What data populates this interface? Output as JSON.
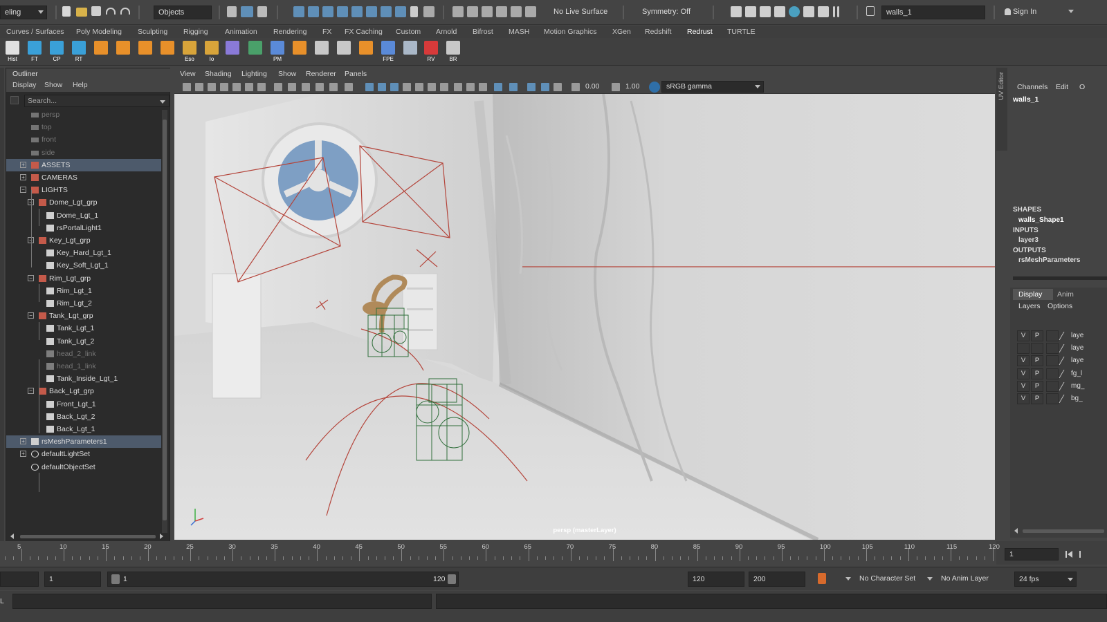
{
  "statusline": {
    "mode_menu": "eling",
    "selection_mask": "Objects",
    "live_surface": "No Live Surface",
    "symmetry": "Symmetry: Off",
    "name_field": "walls_1",
    "sign_in": "Sign In"
  },
  "shelf_tabs": [
    "Curves / Surfaces",
    "Poly Modeling",
    "Sculpting",
    "Rigging",
    "Animation",
    "Rendering",
    "FX",
    "FX Caching",
    "Custom",
    "Arnold",
    "Bifrost",
    "MASH",
    "Motion Graphics",
    "XGen",
    "Redshift",
    "Redrust",
    "TURTLE"
  ],
  "active_shelf_tab": "Redrust",
  "shelf_buttons": [
    {
      "label": "Hist",
      "icon": "history-icon"
    },
    {
      "label": "FT",
      "icon": "freeze-transform-icon"
    },
    {
      "label": "CP",
      "icon": "center-pivot-icon"
    },
    {
      "label": "RT",
      "icon": "reset-transform-icon"
    },
    {
      "label": "",
      "icon": "sphere-grid-icon"
    },
    {
      "label": "",
      "icon": "cube-grid-icon"
    },
    {
      "label": "",
      "icon": "cylinder-grid-icon"
    },
    {
      "label": "",
      "icon": "diamond-icon"
    },
    {
      "label": "Eso",
      "icon": "folder-eso-icon"
    },
    {
      "label": "Io",
      "icon": "folder-io-icon"
    },
    {
      "label": "",
      "icon": "wire-cube-icon"
    },
    {
      "label": "",
      "icon": "uv-grid-icon"
    },
    {
      "label": "PM",
      "icon": "pm-monitor-icon"
    },
    {
      "label": "",
      "icon": "hand-icon"
    },
    {
      "label": "",
      "icon": "mug-icon"
    },
    {
      "label": "",
      "icon": "grid-window-icon"
    },
    {
      "label": "",
      "icon": "align-icon"
    },
    {
      "label": "FPE",
      "icon": "fpe-monitor-icon"
    },
    {
      "label": "",
      "icon": "render-setup-icon"
    },
    {
      "label": "RV",
      "icon": "render-view-icon"
    },
    {
      "label": "BR",
      "icon": "batch-render-icon"
    }
  ],
  "outliner": {
    "title": "Outliner",
    "menus": [
      "Display",
      "Show",
      "Help"
    ],
    "search_placeholder": "Search...",
    "items": [
      {
        "label": "persp",
        "depth": 0,
        "dim": true,
        "icon": "camera-icon",
        "exp": ""
      },
      {
        "label": "top",
        "depth": 0,
        "dim": true,
        "icon": "camera-icon",
        "exp": ""
      },
      {
        "label": "front",
        "depth": 0,
        "dim": true,
        "icon": "camera-icon",
        "exp": ""
      },
      {
        "label": "side",
        "depth": 0,
        "dim": true,
        "icon": "camera-icon",
        "exp": ""
      },
      {
        "label": "ASSETS",
        "depth": 0,
        "icon": "group-icon",
        "exp": "+",
        "selected": true
      },
      {
        "label": "CAMERAS",
        "depth": 0,
        "icon": "group-icon",
        "exp": "+"
      },
      {
        "label": "LIGHTS",
        "depth": 0,
        "icon": "group-icon",
        "exp": "-"
      },
      {
        "label": "Dome_Lgt_grp",
        "depth": 1,
        "icon": "group-icon",
        "exp": "-"
      },
      {
        "label": "Dome_Lgt_1",
        "depth": 2,
        "icon": "light-icon",
        "exp": ""
      },
      {
        "label": "rsPortalLight1",
        "depth": 2,
        "icon": "light-icon",
        "exp": ""
      },
      {
        "label": "Key_Lgt_grp",
        "depth": 1,
        "icon": "group-icon",
        "exp": "-"
      },
      {
        "label": "Key_Hard_Lgt_1",
        "depth": 2,
        "icon": "light-icon",
        "exp": ""
      },
      {
        "label": "Key_Soft_Lgt_1",
        "depth": 2,
        "icon": "light-icon",
        "exp": ""
      },
      {
        "label": "Rim_Lgt_grp",
        "depth": 1,
        "icon": "group-icon",
        "exp": "-"
      },
      {
        "label": "Rim_Lgt_1",
        "depth": 2,
        "icon": "light-icon",
        "exp": ""
      },
      {
        "label": "Rim_Lgt_2",
        "depth": 2,
        "icon": "light-icon",
        "exp": ""
      },
      {
        "label": "Tank_Lgt_grp",
        "depth": 1,
        "icon": "group-icon",
        "exp": "-"
      },
      {
        "label": "Tank_Lgt_1",
        "depth": 2,
        "icon": "light-icon",
        "exp": ""
      },
      {
        "label": "Tank_Lgt_2",
        "depth": 2,
        "icon": "light-icon",
        "exp": ""
      },
      {
        "label": "head_2_link",
        "depth": 2,
        "dim": true,
        "icon": "link-icon",
        "exp": ""
      },
      {
        "label": "head_1_link",
        "depth": 2,
        "dim": true,
        "icon": "link-icon",
        "exp": ""
      },
      {
        "label": "Tank_Inside_Lgt_1",
        "depth": 2,
        "icon": "light-icon",
        "exp": ""
      },
      {
        "label": "Back_Lgt_grp",
        "depth": 1,
        "icon": "group-icon",
        "exp": "-"
      },
      {
        "label": "Front_Lgt_1",
        "depth": 2,
        "icon": "light-icon",
        "exp": ""
      },
      {
        "label": "Back_Lgt_2",
        "depth": 2,
        "icon": "light-icon",
        "exp": ""
      },
      {
        "label": "Back_Lgt_1",
        "depth": 2,
        "icon": "light-icon",
        "exp": ""
      },
      {
        "label": "rsMeshParameters1",
        "depth": 0,
        "icon": "mesh-params-icon",
        "exp": "+",
        "selected": true
      },
      {
        "label": "defaultLightSet",
        "depth": 0,
        "icon": "set-icon",
        "exp": "+"
      },
      {
        "label": "defaultObjectSet",
        "depth": 0,
        "icon": "set-icon",
        "exp": ""
      }
    ]
  },
  "viewport": {
    "menus": [
      "View",
      "Shading",
      "Lighting",
      "Show",
      "Renderer",
      "Panels"
    ],
    "exposure": "0.00",
    "gamma": "1.00",
    "color_space": "sRGB gamma",
    "camera_label": "persp (masterLayer)"
  },
  "channel_box": {
    "uv_editor_tab": "UV Editor",
    "menus": [
      "Channels",
      "Edit",
      "O"
    ],
    "object_name": "walls_1",
    "shapes_header": "SHAPES",
    "shape": "walls_Shape1",
    "inputs_header": "INPUTS",
    "input": "layer3",
    "outputs_header": "OUTPUTS",
    "output": "rsMeshParameters"
  },
  "layer_editor": {
    "tabs": [
      "Display",
      "Anim"
    ],
    "menus": [
      "Layers",
      "Options"
    ],
    "rows": [
      {
        "v": "V",
        "p": "P",
        "name": "laye"
      },
      {
        "v": "",
        "p": "",
        "name": "laye"
      },
      {
        "v": "V",
        "p": "P",
        "name": "laye"
      },
      {
        "v": "V",
        "p": "P",
        "name": "fg_l"
      },
      {
        "v": "V",
        "p": "P",
        "name": "mg_"
      },
      {
        "v": "V",
        "p": "P",
        "name": "bg_"
      }
    ]
  },
  "timeline": {
    "ticks": [
      "5",
      "10",
      "15",
      "20",
      "25",
      "30",
      "35",
      "40",
      "45",
      "50",
      "55",
      "60",
      "65",
      "70",
      "75",
      "80",
      "85",
      "90",
      "95",
      "100",
      "105",
      "110",
      "115",
      "120"
    ],
    "current_frame": "1"
  },
  "range": {
    "start_field": "1",
    "slider_start": "1",
    "slider_end": "120",
    "end_field": "120",
    "anim_end_field": "200",
    "character_set": "No Character Set",
    "anim_layer": "No Anim Layer",
    "fps": "24 fps"
  },
  "command_line": {
    "label": "L"
  },
  "colors": {
    "accent_blue": "#5f8fb8",
    "selection": "#4d5a6b",
    "wire_red": "#b4443a",
    "wire_green": "#2f6e3a"
  }
}
